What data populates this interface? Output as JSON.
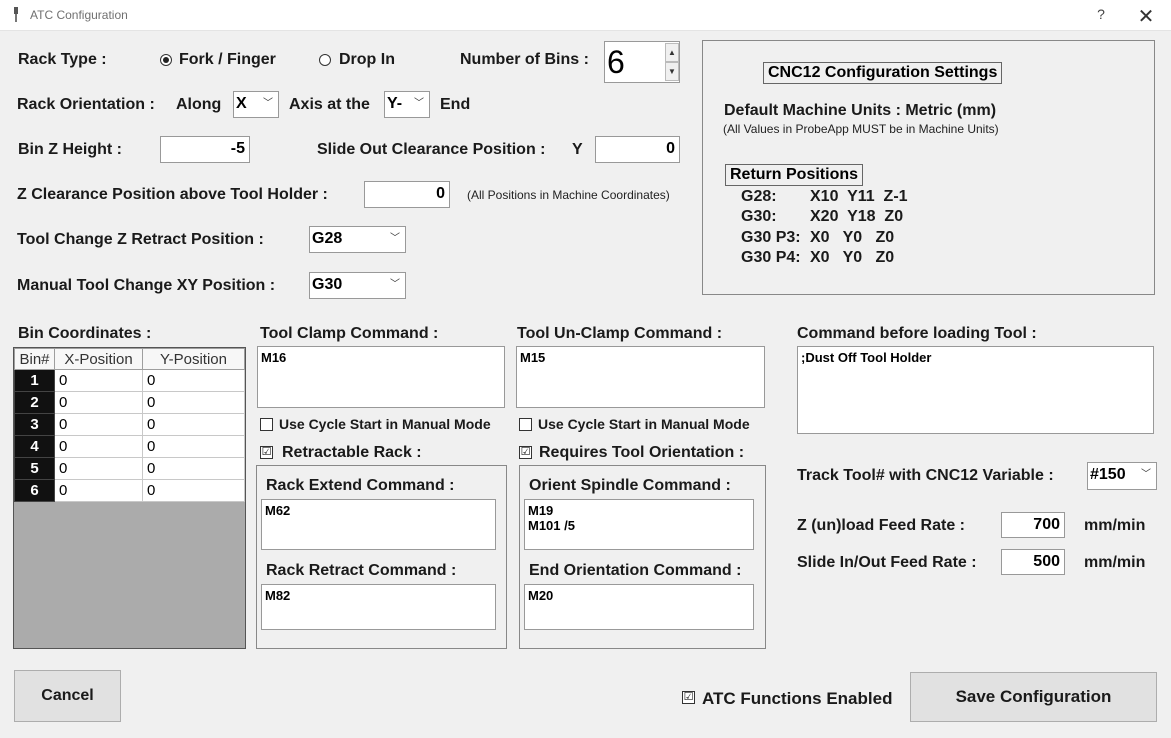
{
  "window": {
    "title": "ATC Configuration",
    "help": "?",
    "close": "✕"
  },
  "rack_type": {
    "label": "Rack Type :",
    "option1": "Fork / Finger",
    "option2": "Drop In",
    "selected": "Fork / Finger"
  },
  "bins": {
    "label": "Number of Bins :",
    "value": "6"
  },
  "orientation": {
    "label": "Rack Orientation :",
    "along": "Along",
    "axis_value": "X",
    "axis_at": "Axis at the",
    "end_value": "Y-",
    "end": "End"
  },
  "bin_z": {
    "label": "Bin Z Height :",
    "value": "-5"
  },
  "slide_out": {
    "label": "Slide Out Clearance Position :",
    "axis": "Y",
    "value": "0"
  },
  "z_clearance": {
    "label": "Z Clearance Position above Tool Holder :",
    "value": "0",
    "note": "(All Positions in Machine Coordinates)"
  },
  "tool_change_z": {
    "label": "Tool Change Z Retract Position :",
    "value": "G28"
  },
  "manual_xy": {
    "label": "Manual Tool Change XY Position :",
    "value": "G30"
  },
  "cnc12": {
    "title": "CNC12 Configuration Settings",
    "units": "Default Machine Units : Metric (mm)",
    "units_note": "(All Values in ProbeApp MUST be in Machine Units)",
    "return_title": "Return Positions",
    "rows": [
      {
        "name": "G28:",
        "vals": "X10  Y11  Z-1"
      },
      {
        "name": "G30:",
        "vals": "X20  Y18  Z0"
      },
      {
        "name": "G30 P3:",
        "vals": "X0   Y0   Z0"
      },
      {
        "name": "G30 P4:",
        "vals": "X0   Y0   Z0"
      }
    ]
  },
  "bin_coords": {
    "label": "Bin Coordinates :",
    "headers": [
      "Bin#",
      "X-Position",
      "Y-Position"
    ],
    "rows": [
      [
        "1",
        "0",
        "0"
      ],
      [
        "2",
        "0",
        "0"
      ],
      [
        "3",
        "0",
        "0"
      ],
      [
        "4",
        "0",
        "0"
      ],
      [
        "5",
        "0",
        "0"
      ],
      [
        "6",
        "0",
        "0"
      ]
    ]
  },
  "clamp": {
    "label": "Tool Clamp Command :",
    "value": "M16",
    "cycle_label": "Use Cycle Start in Manual Mode",
    "cycle_checked": false
  },
  "unclamp": {
    "label": "Tool Un-Clamp Command :",
    "value": "M15",
    "cycle_label": "Use Cycle Start in Manual Mode",
    "cycle_checked": false
  },
  "retractable": {
    "label": "Retractable Rack :",
    "checked": true,
    "extend_label": "Rack Extend Command :",
    "extend_value": "M62",
    "retract_label": "Rack Retract Command :",
    "retract_value": "M82"
  },
  "orientation_req": {
    "label": "Requires Tool Orientation :",
    "checked": true,
    "orient_label": "Orient Spindle Command :",
    "orient_value": "M19\nM101 /5",
    "end_label": "End Orientation Command :",
    "end_value": "M20"
  },
  "before_loading": {
    "label": "Command before loading Tool :",
    "value": ";Dust Off Tool Holder"
  },
  "track_tool": {
    "label": "Track Tool# with CNC12 Variable :",
    "value": "#150"
  },
  "feed": {
    "z_label": "Z (un)load Feed Rate :",
    "z_value": "700",
    "z_unit": "mm/min",
    "slide_label": "Slide In/Out Feed Rate :",
    "slide_value": "500",
    "slide_unit": "mm/min"
  },
  "footer": {
    "cancel": "Cancel",
    "atc_enabled_label": "ATC Functions Enabled",
    "atc_enabled": true,
    "save": "Save Configuration"
  },
  "icons": {
    "check": "☑",
    "unchecked": "☐",
    "dropdown": "chevron-down-icon",
    "spin_up": "▲",
    "spin_down": "▼"
  }
}
